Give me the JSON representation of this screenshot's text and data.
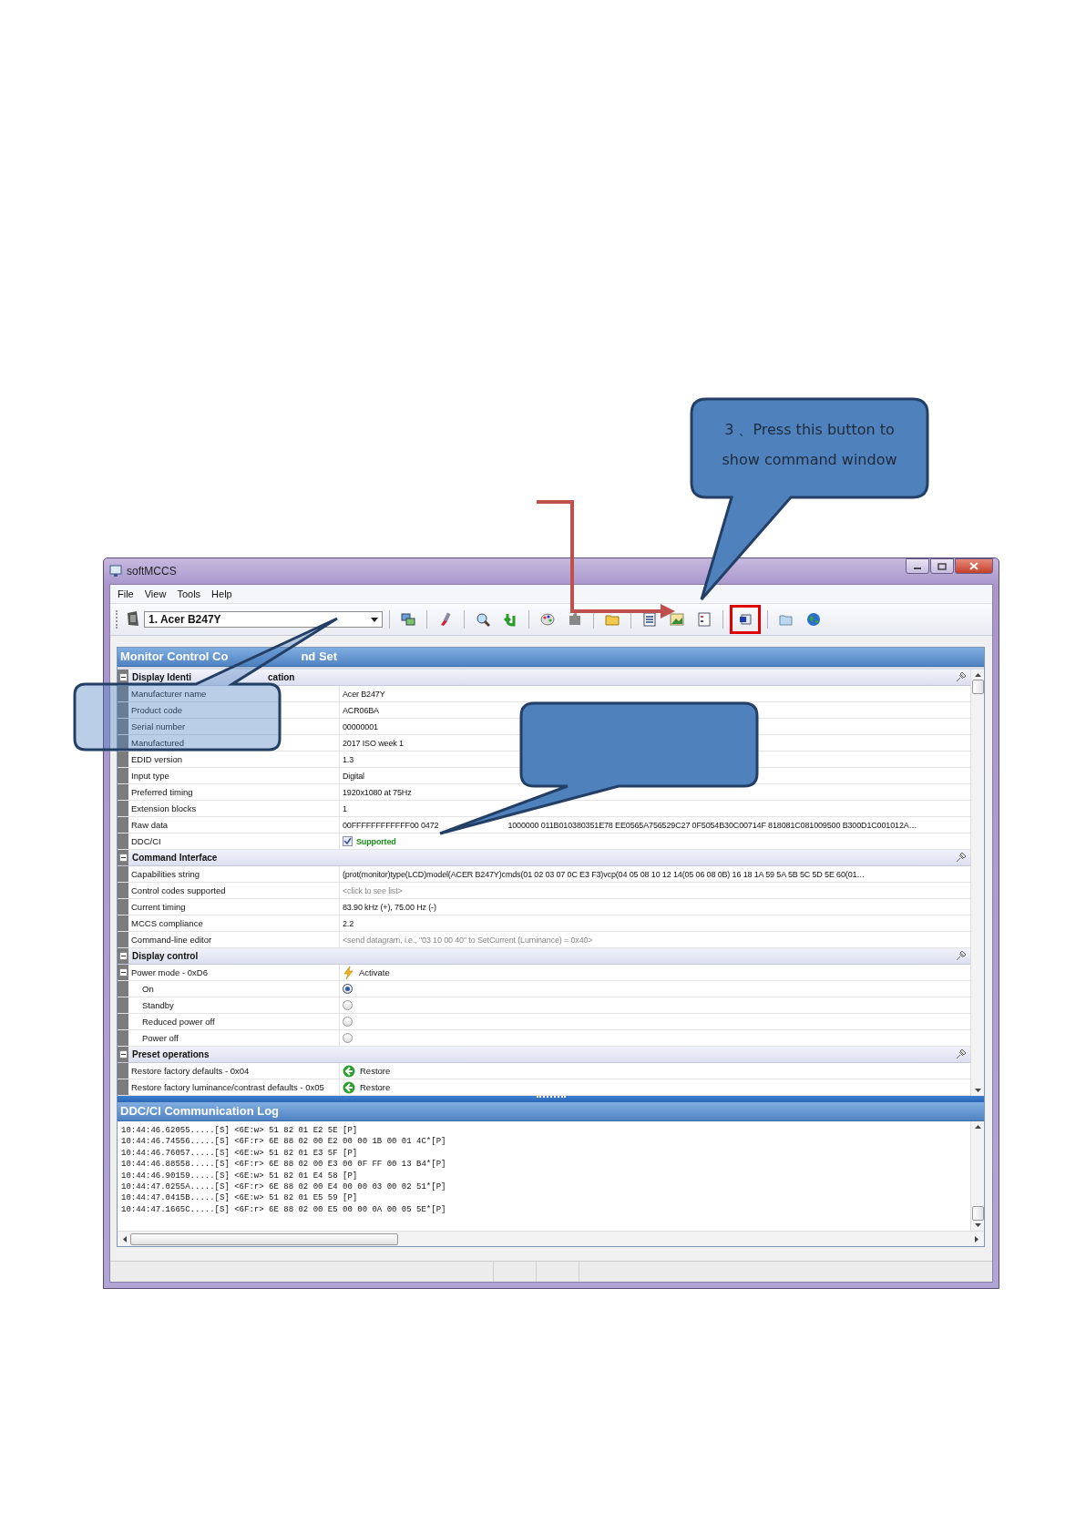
{
  "window": {
    "title": "softMCCS"
  },
  "menu": [
    {
      "label": "File"
    },
    {
      "label": "View"
    },
    {
      "label": "Tools"
    },
    {
      "label": "Help"
    }
  ],
  "toolbar": {
    "monitor": "1. Acer B247Y",
    "groups": [
      [
        {
          "kind": "screens",
          "highlighted": false
        }
      ],
      [
        {
          "kind": "brush",
          "highlighted": false
        }
      ],
      [
        {
          "kind": "magnifier",
          "highlighted": false
        },
        {
          "kind": "undo",
          "highlighted": false
        }
      ],
      [
        {
          "kind": "palette",
          "highlighted": false
        },
        {
          "kind": "puzzle",
          "highlighted": false
        }
      ],
      [
        {
          "kind": "folder",
          "highlighted": false
        }
      ],
      [
        {
          "kind": "list",
          "highlighted": false
        },
        {
          "kind": "image",
          "highlighted": false
        },
        {
          "kind": "form",
          "highlighted": false
        }
      ],
      [
        {
          "kind": "window",
          "highlighted": true
        }
      ],
      [
        {
          "kind": "open-folder",
          "highlighted": false
        },
        {
          "kind": "globe",
          "highlighted": false
        }
      ]
    ]
  },
  "command_set": {
    "title_parts": [
      "Monitor Control Co",
      "nd Set"
    ],
    "sections": [
      {
        "title_parts": [
          "Display Identi",
          "cation"
        ],
        "expanded": true,
        "rows": [
          {
            "kind": "text",
            "label": "Manufacturer name",
            "value": "Acer B247Y"
          },
          {
            "kind": "text",
            "label": "Product code",
            "value": "ACR06BA"
          },
          {
            "kind": "text",
            "label": "Serial number",
            "value": "00000001"
          },
          {
            "kind": "text",
            "label": "Manufactured",
            "value": "2017 ISO week 1"
          },
          {
            "kind": "text",
            "label": "EDID version",
            "value": "1.3"
          },
          {
            "kind": "text",
            "label": "Input type",
            "value": "Digital"
          },
          {
            "kind": "text",
            "label": "Preferred timing",
            "value": "1920x1080 at 75Hz"
          },
          {
            "kind": "text",
            "label": "Extension blocks",
            "value": "1"
          },
          {
            "kind": "partial",
            "label": "Raw data",
            "parts": [
              "00FFFFFFFFFFFF00 0472",
              "1000000 011B010380351E78 EE0565A756529C27 0F5054B30C00714F 818081C081009500 B300D1C001012A…"
            ]
          },
          {
            "kind": "check",
            "label": "DDC/CI",
            "value": "Supported",
            "checked": true
          }
        ]
      },
      {
        "title_parts": [
          "Command Interface"
        ],
        "expanded": true,
        "rows": [
          {
            "kind": "text",
            "label": "Capabilities string",
            "value": "(prot(monitor)type(LCD)model(ACER B247Y)cmds(01 02 03 07 0C E3 F3)vcp(04 05 08 10 12 14(05 06 08 0B) 16 18 1A 59 5A 5B 5C 5D 5E 60(01…"
          },
          {
            "kind": "hint",
            "label": "Control codes supported",
            "value": "<click to see list>"
          },
          {
            "kind": "text",
            "label": "Current timing",
            "value": "83.90 kHz (+), 75.00 Hz (-)"
          },
          {
            "kind": "text",
            "label": "MCCS compliance",
            "value": "2.2"
          },
          {
            "kind": "hint",
            "label": "Command-line editor",
            "value": "<send datagram, i.e., \"03 10 00 40\" to SetCurrent (Luminance) = 0x40>"
          }
        ]
      },
      {
        "title_parts": [
          "Display control"
        ],
        "expanded": true,
        "rows": [
          {
            "kind": "group",
            "label": "Power mode - 0xD6",
            "value": "Activate",
            "expanded": true,
            "children": [
              {
                "label": "On",
                "selected": true
              },
              {
                "label": "Standby",
                "selected": false
              },
              {
                "label": "Reduced power off",
                "selected": false
              },
              {
                "label": "Power off",
                "selected": false
              }
            ]
          }
        ]
      },
      {
        "title_parts": [
          "Preset operations"
        ],
        "expanded": true,
        "rows": [
          {
            "kind": "restore",
            "label": "Restore factory defaults - 0x04",
            "value": "Restore"
          },
          {
            "kind": "restore",
            "label": "Restore factory luminance/contrast defaults - 0x05",
            "value": "Restore"
          }
        ]
      }
    ]
  },
  "log": {
    "title": "DDC/CI Communication Log",
    "lines": [
      "10:44:46.62055.....[S] <6E:w> 51 82 01 E2 5E [P]",
      "10:44:46.74556.....[S] <6F:r> 6E 88 02 00 E2 00 00 1B 00 01 4C*[P]",
      "10:44:46.76057.....[S] <6E:w> 51 82 01 E3 5F [P]",
      "10:44:46.88558.....[S] <6F:r> 6E 88 02 00 E3 00 0F FF 00 13 B4*[P]",
      "10:44:46.90159.....[S] <6E:w> 51 82 01 E4 58 [P]",
      "10:44:47.0255A.....[S] <6F:r> 6E 88 02 00 E4 00 00 03 00 02 51*[P]",
      "10:44:47.0415B.....[S] <6E:w> 51 82 01 E5 59 [P]",
      "10:44:47.1665C.....[S] <6F:r> 6E 88 02 00 E5 00 00 0A 00 05 5E*[P]"
    ]
  },
  "annotation": {
    "lines": [
      "3 、Press this button to",
      "show command window"
    ]
  }
}
